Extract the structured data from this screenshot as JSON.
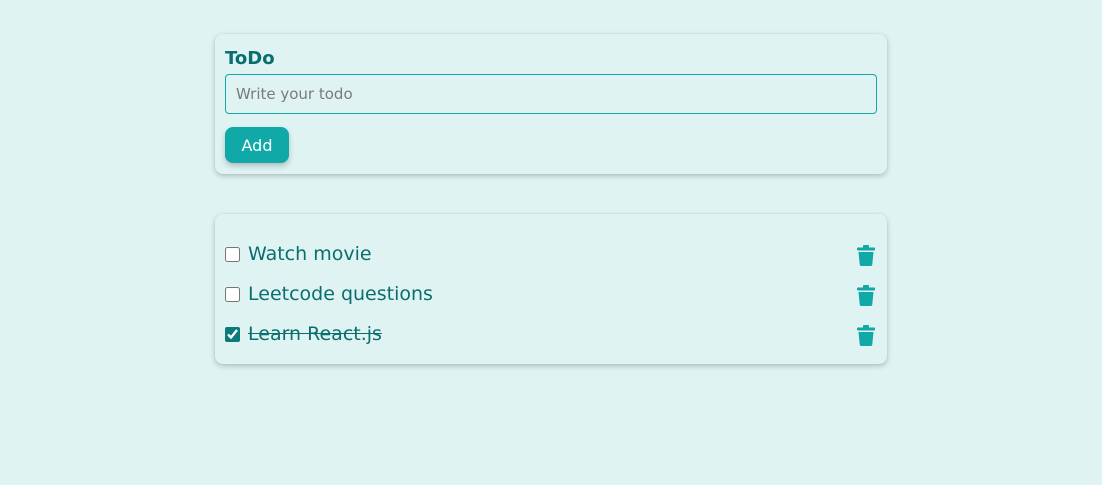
{
  "form": {
    "title": "ToDo",
    "input_placeholder": "Write your todo",
    "input_value": "",
    "add_label": "Add"
  },
  "todos": [
    {
      "text": "Watch movie",
      "completed": false
    },
    {
      "text": "Leetcode questions",
      "completed": false
    },
    {
      "text": "Learn React.js",
      "completed": true
    }
  ],
  "colors": {
    "background": "#e0f3f3",
    "accent": "#11a8a8",
    "text": "#0a6e6e"
  },
  "icons": {
    "delete": "trash-icon"
  }
}
